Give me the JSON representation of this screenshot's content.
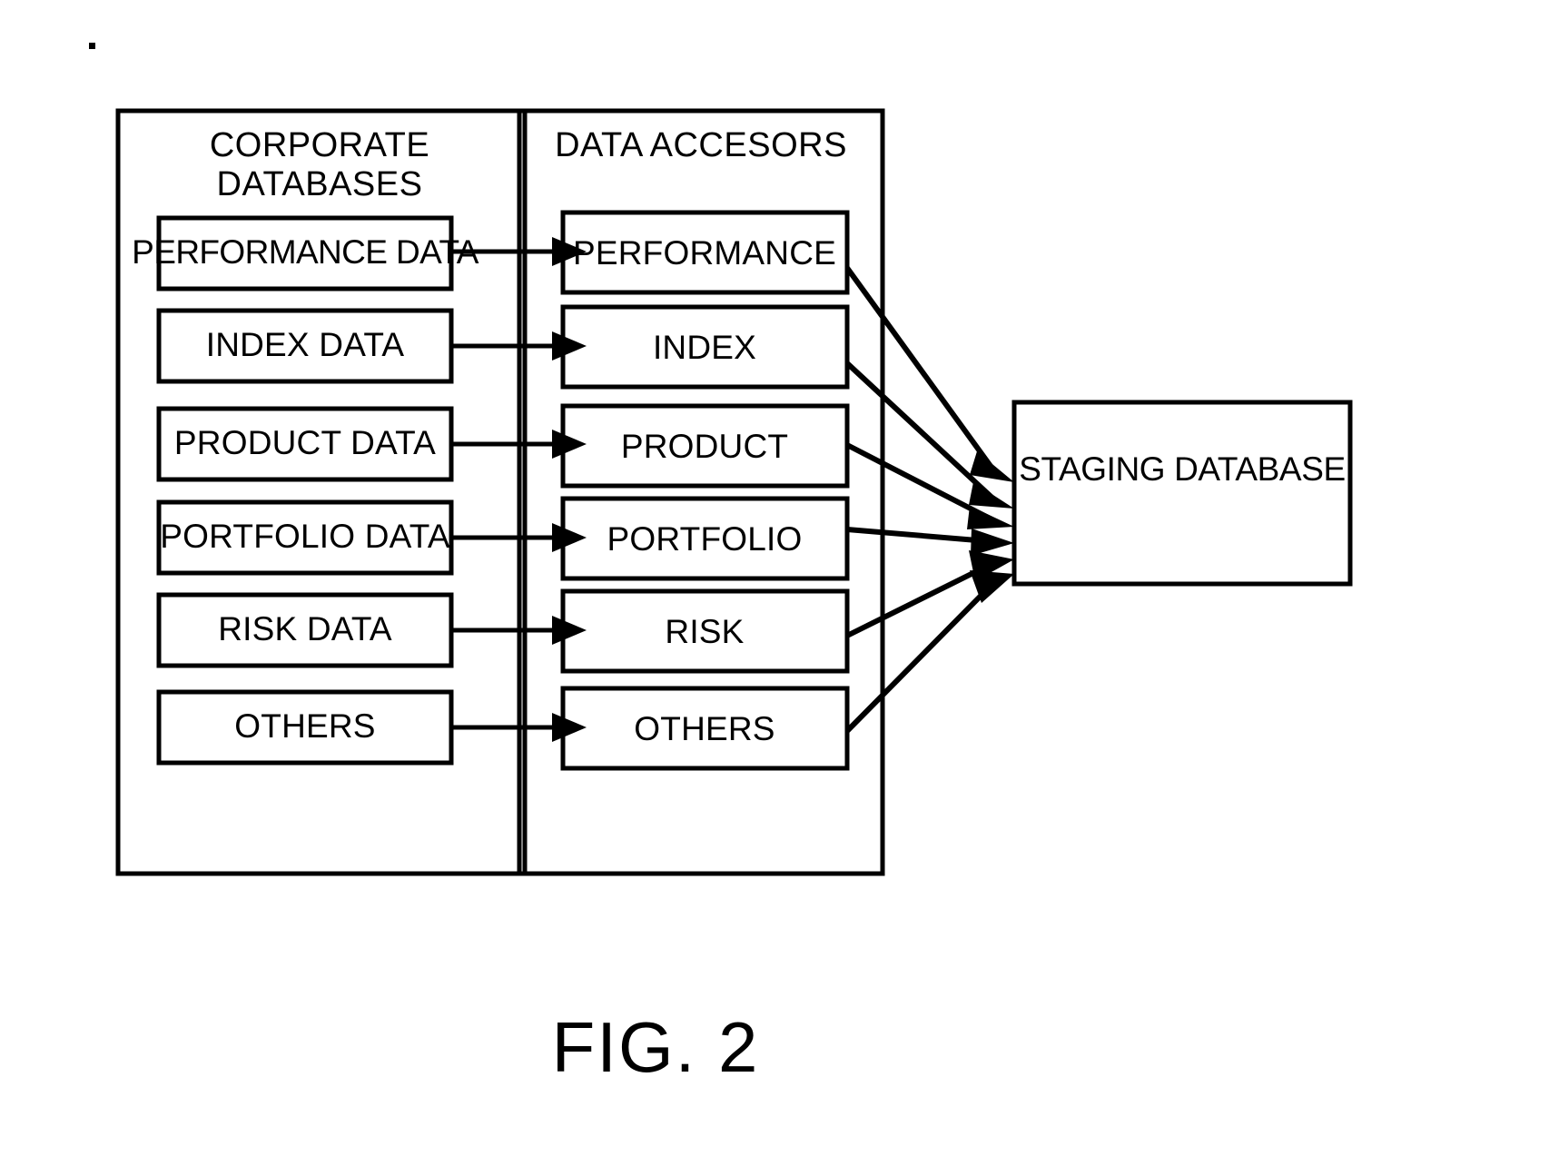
{
  "figure": {
    "caption": "FIG. 2",
    "groups": [
      {
        "id": "corporate-databases",
        "title_line1": "CORPORATE",
        "title_line2": "DATABASES",
        "boxes": [
          {
            "label": "PERFORMANCE DATA"
          },
          {
            "label": "INDEX DATA"
          },
          {
            "label": "PRODUCT DATA"
          },
          {
            "label": "PORTFOLIO DATA"
          },
          {
            "label": "RISK DATA"
          },
          {
            "label": "OTHERS"
          }
        ]
      },
      {
        "id": "data-accessors",
        "title_line1": "DATA ACCESORS",
        "title_line2": "",
        "boxes": [
          {
            "label": "PERFORMANCE"
          },
          {
            "label": "INDEX"
          },
          {
            "label": "PRODUCT"
          },
          {
            "label": "PORTFOLIO"
          },
          {
            "label": "RISK"
          },
          {
            "label": "OTHERS"
          }
        ]
      }
    ],
    "staging": {
      "label": "STAGING DATABASE"
    },
    "colors": {
      "stroke": "#000000",
      "fill": "#ffffff",
      "background": "#ffffff"
    },
    "flows": [
      {
        "from": "PERFORMANCE DATA",
        "to": "PERFORMANCE"
      },
      {
        "from": "INDEX DATA",
        "to": "INDEX"
      },
      {
        "from": "PRODUCT DATA",
        "to": "PRODUCT"
      },
      {
        "from": "PORTFOLIO DATA",
        "to": "PORTFOLIO"
      },
      {
        "from": "RISK DATA",
        "to": "RISK"
      },
      {
        "from": "OTHERS",
        "to": "OTHERS"
      },
      {
        "from": "PERFORMANCE",
        "to": "STAGING DATABASE"
      },
      {
        "from": "INDEX",
        "to": "STAGING DATABASE"
      },
      {
        "from": "PRODUCT",
        "to": "STAGING DATABASE"
      },
      {
        "from": "PORTFOLIO",
        "to": "STAGING DATABASE"
      },
      {
        "from": "RISK",
        "to": "STAGING DATABASE"
      },
      {
        "from": "OTHERS",
        "to": "STAGING DATABASE"
      }
    ]
  }
}
